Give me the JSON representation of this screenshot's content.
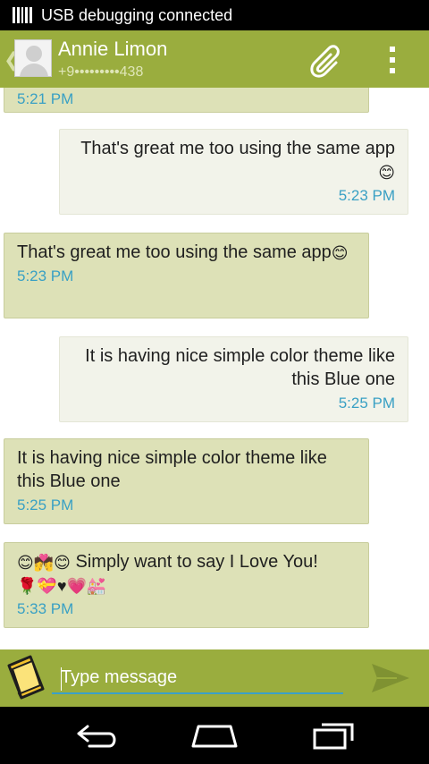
{
  "status_bar": {
    "notification_text": "USB debugging connected",
    "notification_icon": "usb-debug-icon"
  },
  "header": {
    "contact_name": "Annie Limon",
    "contact_phone": "+9•••••••••438",
    "attach_icon": "paperclip-icon",
    "overflow_icon": "overflow-menu-icon"
  },
  "messages": [
    {
      "direction": "in",
      "text": "",
      "time": "5:21 PM"
    },
    {
      "direction": "out",
      "text": "That's great me too using the same app",
      "emoji": "😊",
      "time": "5:23 PM"
    },
    {
      "direction": "in",
      "text": "That's great me too using the same app",
      "emoji": "😊",
      "time": "5:23 PM"
    },
    {
      "direction": "out",
      "text": "It is having nice simple color theme like this Blue one",
      "time": "5:25 PM"
    },
    {
      "direction": "in",
      "text": "It is having nice simple color theme like this Blue one",
      "time": "5:25 PM"
    },
    {
      "direction": "in",
      "emoji_prefix": "😊💏😊",
      "text": "Simply want to say I Love You!",
      "emoji_suffix": "🌹💝♥💗💒",
      "time": "5:33 PM"
    }
  ],
  "composer": {
    "placeholder": "Type message",
    "sticker_icon": "emoji-book-icon",
    "send_icon": "send-icon"
  },
  "nav": {
    "back": "back-icon",
    "home": "home-icon",
    "recents": "recents-icon"
  },
  "colors": {
    "accent": "#9aad3e",
    "incoming_bubble": "#dde1b7",
    "outgoing_bubble": "#f2f3ea",
    "time_text": "#39a0c4"
  }
}
